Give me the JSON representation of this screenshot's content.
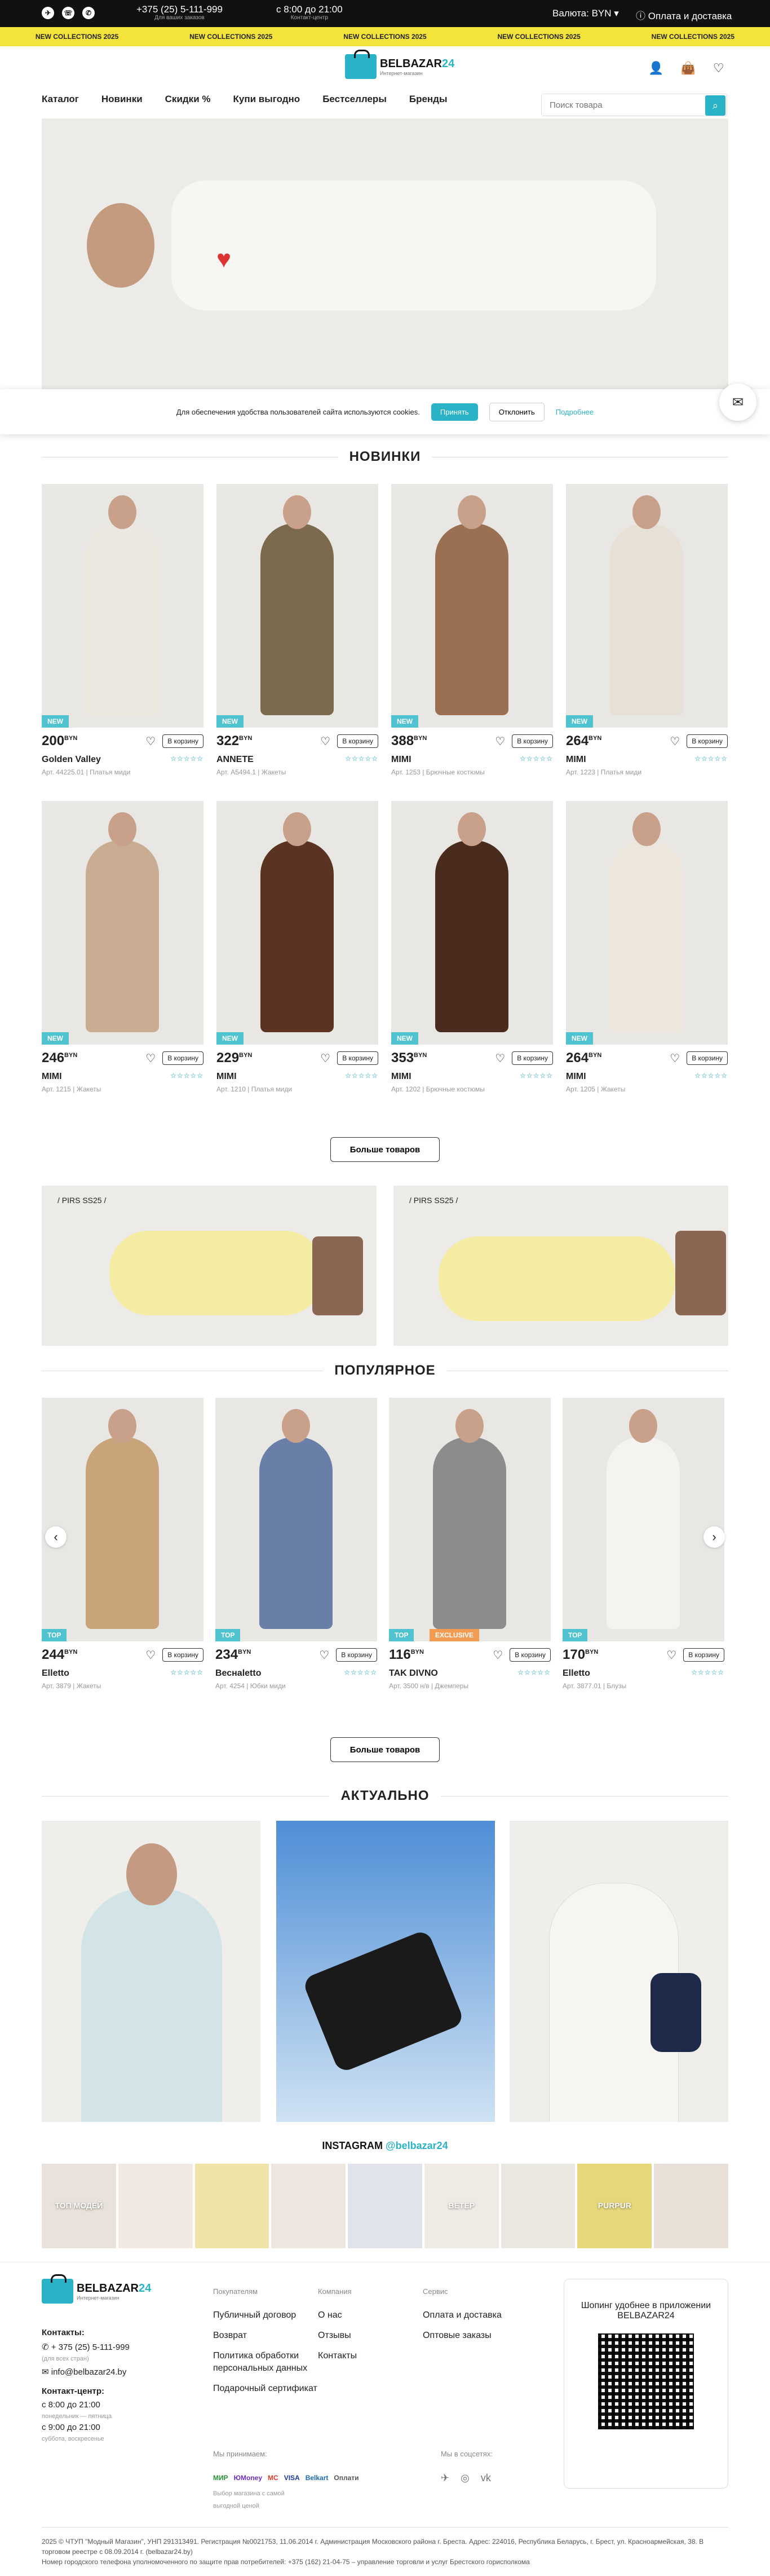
{
  "topbar": {
    "phone": "+375 (25) 5-111-999",
    "phone_note": "Для ваших заказов",
    "hours": "с 8:00 до 21:00",
    "hours_note": "Контакт-центр",
    "currency": "Валюта: BYN",
    "delivery": "Оплата и доставка"
  },
  "marquee": [
    "NEW COLLECTIONS 2025",
    "NEW COLLECTIONS 2025",
    "NEW COLLECTIONS 2025",
    "NEW COLLECTIONS 2025",
    "NEW COLLECTIONS 2025"
  ],
  "logo": {
    "name": "BELBAZAR",
    "num": "24",
    "tagline": "Интернет-магазин"
  },
  "nav": [
    "Каталог",
    "Новинки",
    "Скидки %",
    "Купи выгодно",
    "Бестселлеры",
    "Бренды"
  ],
  "search": {
    "placeholder": "Поиск товара"
  },
  "cookie": {
    "text": "Для обеспечения удобства пользователей сайта используются cookies.",
    "accept": "Принять",
    "decline": "Отклонить",
    "more": "Подробнее"
  },
  "sections": {
    "new": "НОВИНКИ",
    "popular": "ПОПУЛЯРНОЕ",
    "actual": "АКТУАЛЬНО"
  },
  "product_labels": {
    "cart": "В корзину",
    "currency": "BYN",
    "more": "Больше товаров"
  },
  "new_products": [
    {
      "badge": "NEW",
      "price": "200",
      "name": "Golden Valley",
      "art": "Арт. 44225.01",
      "cat": "Платья миди",
      "coat": "#ece8e0"
    },
    {
      "badge": "NEW",
      "price": "322",
      "name": "ANNETE",
      "art": "Арт. А5494.1",
      "cat": "Жакеты",
      "coat": "#7b6a4d"
    },
    {
      "badge": "NEW",
      "price": "388",
      "name": "MIMI",
      "art": "Арт. 1253",
      "cat": "Брючные костюмы",
      "coat": "#9a6f52"
    },
    {
      "badge": "NEW",
      "price": "264",
      "name": "MIMI",
      "art": "Арт. 1223",
      "cat": "Платья миди",
      "coat": "#e6e0d6"
    },
    {
      "badge": "NEW",
      "price": "246",
      "name": "MIMI",
      "art": "Арт. 1215",
      "cat": "Жакеты",
      "coat": "#c9ad92"
    },
    {
      "badge": "NEW",
      "price": "229",
      "name": "MIMI",
      "art": "Арт. 1210",
      "cat": "Платья миди",
      "coat": "#5b3322"
    },
    {
      "badge": "NEW",
      "price": "353",
      "name": "MIMI",
      "art": "Арт. 1202",
      "cat": "Брючные костюмы",
      "coat": "#4a2c1f"
    },
    {
      "badge": "NEW",
      "price": "264",
      "name": "MIMI",
      "art": "Арт. 1205",
      "cat": "Жакеты",
      "coat": "#ece6dc"
    }
  ],
  "promos": [
    {
      "text": "/ PIRS SS25 /"
    },
    {
      "text": "/ PIRS SS25 /"
    }
  ],
  "popular_products": [
    {
      "badge": "TOP",
      "extra": "",
      "price": "244",
      "name": "Elletto",
      "art": "Арт. 3879",
      "cat": "Жакеты",
      "coat": "#c9a47a"
    },
    {
      "badge": "TOP",
      "extra": "",
      "price": "234",
      "name": "Веснаletto",
      "art": "Арт. 4254",
      "cat": "Юбки миди",
      "coat": "#6a7fa8"
    },
    {
      "badge": "TOP",
      "extra": "EXCLUSIVE",
      "price": "116",
      "name": "TAK DIVNO",
      "art": "Арт. 3500 н/в",
      "cat": "Джемперы",
      "coat": "#8c8c8c"
    },
    {
      "badge": "TOP",
      "extra": "",
      "price": "170",
      "name": "Elletto",
      "art": "Арт. 3877.01",
      "cat": "Блузы",
      "coat": "#f5f3ef"
    }
  ],
  "instagram": {
    "label": "INSTAGRAM",
    "handle": "@belbazar24"
  },
  "insta_tiles": [
    "ТОП МОДЕЙ",
    "",
    "",
    "",
    "",
    "ВЕТЕР",
    "",
    "PURPUR",
    ""
  ],
  "footer": {
    "contacts_h": "Контакты:",
    "phone": "+ 375 (25) 5-111-999",
    "phone_note": "(для всех стран)",
    "email": "info@belbazar24.by",
    "center_h": "Контакт-центр:",
    "hours1": "с 8:00 до 21:00",
    "hours1_note": "понедельник — пятница",
    "hours2": "с 9:00 до 21:00",
    "hours2_note": "суббота, воскресенье",
    "col1_h": "Покупателям",
    "col1": [
      "Публичный договор",
      "Возврат",
      "Политика обработки персональных данных",
      "Подарочный сертификат"
    ],
    "col2_h": "Компания",
    "col2": [
      "О нас",
      "Отзывы",
      "Контакты"
    ],
    "col3_h": "Сервис",
    "col3": [
      "Оплата и доставка",
      "Оптовые заказы"
    ],
    "pay_h": "Мы принимаем:",
    "pay": [
      "МИР",
      "ЮMoney",
      "MC",
      "VISA",
      "Belkart",
      "Оплати"
    ],
    "pay_note": "Выбор магазина с самой выгодной ценой",
    "soc_h": "Мы в соцсетях:",
    "app_text": "Шопинг удобнее в приложении BELBAZAR24",
    "copy": "2025 © ЧТУП \"Модный Магазин\", УНП 291313491. Регистрация №0021753, 11.06.2014 г. Администрация Московского района г. Бреста. Адрес: 224016, Республика Беларусь, г. Брест, ул. Красноармейская, 38. В торговом реестре с 08.09.2014 г. (belbazar24.by)",
    "copy2": "Номер городского телефона уполномоченного по защите прав потребителей: +375 (162) 21-04-75 – управление торговли и услуг Брестского горисполкома"
  }
}
